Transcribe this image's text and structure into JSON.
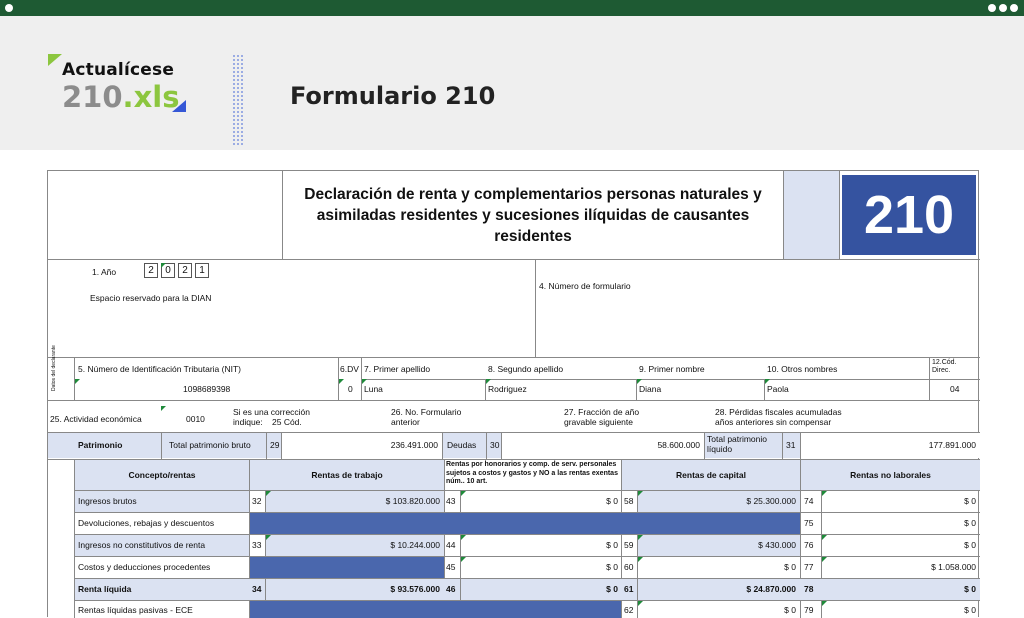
{
  "app": {
    "brand_name": "Actualícese",
    "file_name": "210",
    "file_ext": ".xls",
    "page_title": "Formulario 210"
  },
  "form": {
    "title": "Declaración de renta y complementarios personas naturales y asimiladas residentes y sucesiones ilíquidas de causantes residentes",
    "form_number": "210",
    "year_label": "1. Año",
    "year_digits": [
      "2",
      "0",
      "2",
      "1"
    ],
    "dian_space_label": "Espacio reservado para la DIAN",
    "form_number_label": "4. Número de formulario",
    "declarant_side_label": "Datos del declarante",
    "nit_label": "5. Número de Identificación Tributaria (NIT)",
    "dv_label": "6.DV",
    "first_surname_label": "7. Primer apellido",
    "second_surname_label": "8. Segundo apellido",
    "first_name_label": "9. Primer nombre",
    "other_names_label": "10. Otros nombres",
    "dir_code_label": "12.Cód. Direc.",
    "nit_value": "1098689398",
    "dv_value": "0",
    "first_surname": "Luna",
    "second_surname": "Rodriguez",
    "first_name": "Diana",
    "other_names": "Paola",
    "dir_code": "04",
    "activity_label": "25. Actividad económica",
    "activity_value": "0010",
    "correction_label_1": "Si es una corrección",
    "correction_label_2": "indique:",
    "correction_code_label": "25 Cód.",
    "prev_form_label_1": "26. No. Formulario",
    "prev_form_label_2": "anterior",
    "fraction_label_1": "27. Fracción de año",
    "fraction_label_2": "gravable siguiente",
    "losses_label_1": "28. Pérdidas fiscales acumuladas",
    "losses_label_2": "años anteriores sin compensar"
  },
  "patrimonio": {
    "section_label": "Patrimonio",
    "gross_label": "Total patrimonio bruto",
    "gross_box": "29",
    "gross_value": "236.491.000",
    "debts_label": "Deudas",
    "debts_box": "30",
    "debts_value": "58.600.000",
    "net_label": "Total patrimonio líquido",
    "net_box": "31",
    "net_value": "177.891.000"
  },
  "rentas_table": {
    "headers": {
      "concept": "Concepto/rentas",
      "work": "Rentas de trabajo",
      "fees": "Rentas por honorarios y comp. de serv. personales sujetos a costos y gastos y NO a las rentas exentas núm.. 10 art.",
      "capital": "Rentas de capital",
      "non_work": "Rentas no laborales"
    },
    "rows": [
      {
        "label": "Ingresos brutos",
        "b1": "32",
        "v1": "$ 103.820.000",
        "b2": "43",
        "v2": "$ 0",
        "b3": "58",
        "v3": "$ 25.300.000",
        "b4": "74",
        "v4": "$ 0"
      },
      {
        "label": "Devoluciones, rebajas y descuentos",
        "b1": "",
        "v1": "",
        "b2": "",
        "v2": "",
        "b3": "",
        "v3": "",
        "b4": "75",
        "v4": "$ 0"
      },
      {
        "label": "Ingresos no constitutivos de renta",
        "b1": "33",
        "v1": "$ 10.244.000",
        "b2": "44",
        "v2": "$ 0",
        "b3": "59",
        "v3": "$ 430.000",
        "b4": "76",
        "v4": "$ 0"
      },
      {
        "label": "Costos y deducciones procedentes",
        "b1": "",
        "v1": "",
        "b2": "45",
        "v2": "$ 0",
        "b3": "60",
        "v3": "$ 0",
        "b4": "77",
        "v4": "$ 1.058.000"
      },
      {
        "label": "Renta líquida",
        "b1": "34",
        "v1": "$ 93.576.000",
        "b2": "46",
        "v2": "$ 0",
        "b3": "61",
        "v3": "$ 24.870.000",
        "b4": "78",
        "v4": "$ 0"
      },
      {
        "label": "Rentas líquidas pasivas - ECE",
        "b1": "",
        "v1": "",
        "b2": "",
        "v2": "",
        "b3": "62",
        "v3": "$ 0",
        "b4": "79",
        "v4": "$ 0"
      }
    ]
  },
  "colors": {
    "chrome": "#1e5a33",
    "accent_green": "#8cc63f",
    "accent_blue": "#3557d6",
    "form_blue": "#3553a0",
    "row_band": "#dbe2f2"
  }
}
